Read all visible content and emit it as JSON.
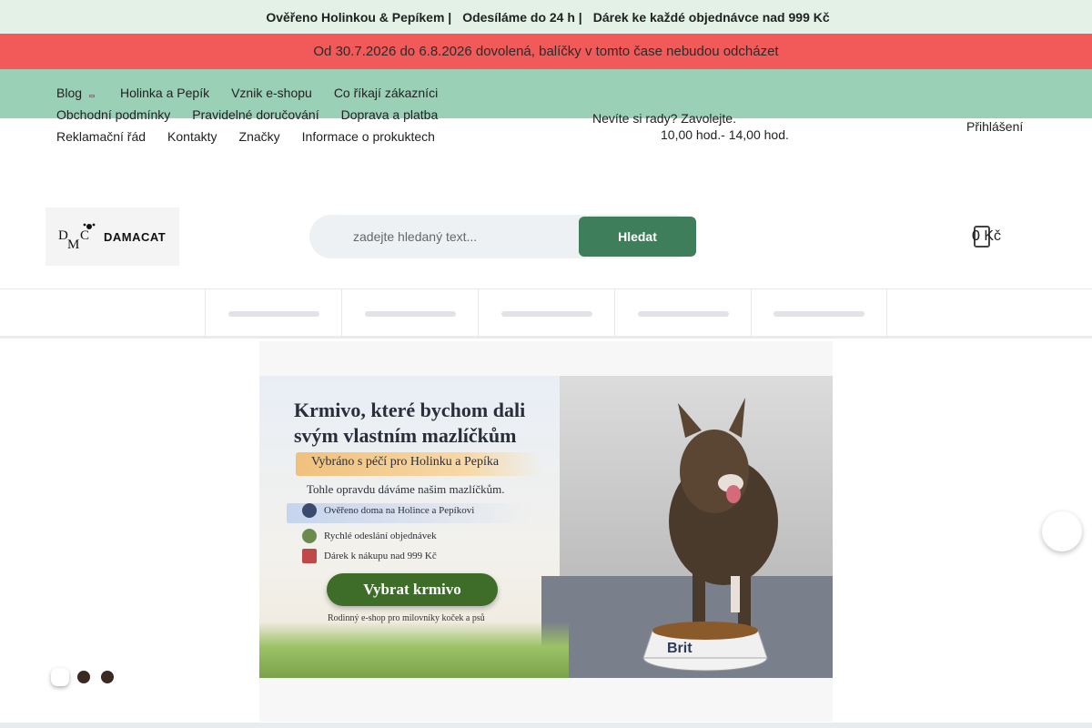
{
  "topbar": {
    "glyph": "",
    "segments": [
      "Ověřeno Holinkou & Pepíkem |",
      "Odesíláme do 24 h |",
      "Dárek ke každé objednávce nad 999 Kč"
    ]
  },
  "alert": {
    "text": "Od 30.7.2026 do 6.8.2026 dovolená, balíčky v tomto čase nebudou odcházet"
  },
  "nav": {
    "rows": [
      [
        "Blog",
        "Holinka a Pepík",
        "Vznik e-shopu",
        "Co říkají zákazníci"
      ],
      [
        "Obchodní podmínky",
        "Pravidelné doručování",
        "Doprava a platba"
      ],
      [
        "Reklamační řád",
        "Kontakty",
        "Značky",
        "Informace o prokuktech"
      ]
    ],
    "holinka_icon": ""
  },
  "help": {
    "line1": "Nevíte si rady? Zavolejte.",
    "line2": "10,00 hod.- 14,00 hod."
  },
  "user": {
    "icon": "",
    "login_icon": "",
    "login_label": "Přihlášení"
  },
  "logo": {
    "brand": "DAMACAT",
    "monogram": "DMC"
  },
  "search": {
    "icon": "",
    "placeholder": "zadejte hledaný text...",
    "button_label": "Hledat"
  },
  "cart": {
    "count": "0",
    "total": "0 Kč"
  },
  "hero": {
    "heading_line1": "Krmivo, které bychom dali",
    "heading_line2": "svým vlastním mazlíčkům",
    "subtitle": "Vybráno s péčí pro Holinku a Pepíka",
    "description": "Tohle opravdu dáváme našim mazlíčkům.",
    "features": [
      "Ověřeno doma na Holince a Pepíkovi",
      "Rychlé odeslání objednávek",
      "Dárek k nákupu nad 999 Kč"
    ],
    "cta_label": "Vybrat krmivo",
    "footer": "Rodinný e-shop pro milovníky koček a psů",
    "bowl_brand": "Brit"
  },
  "carousel": {
    "next_icon": "",
    "slide_count": 3,
    "active_index": 0
  },
  "colors": {
    "accent": "#3e7e5a",
    "alert": "#f25a5a",
    "band": "#99d0b6",
    "topbar": "#e3f1e6"
  }
}
